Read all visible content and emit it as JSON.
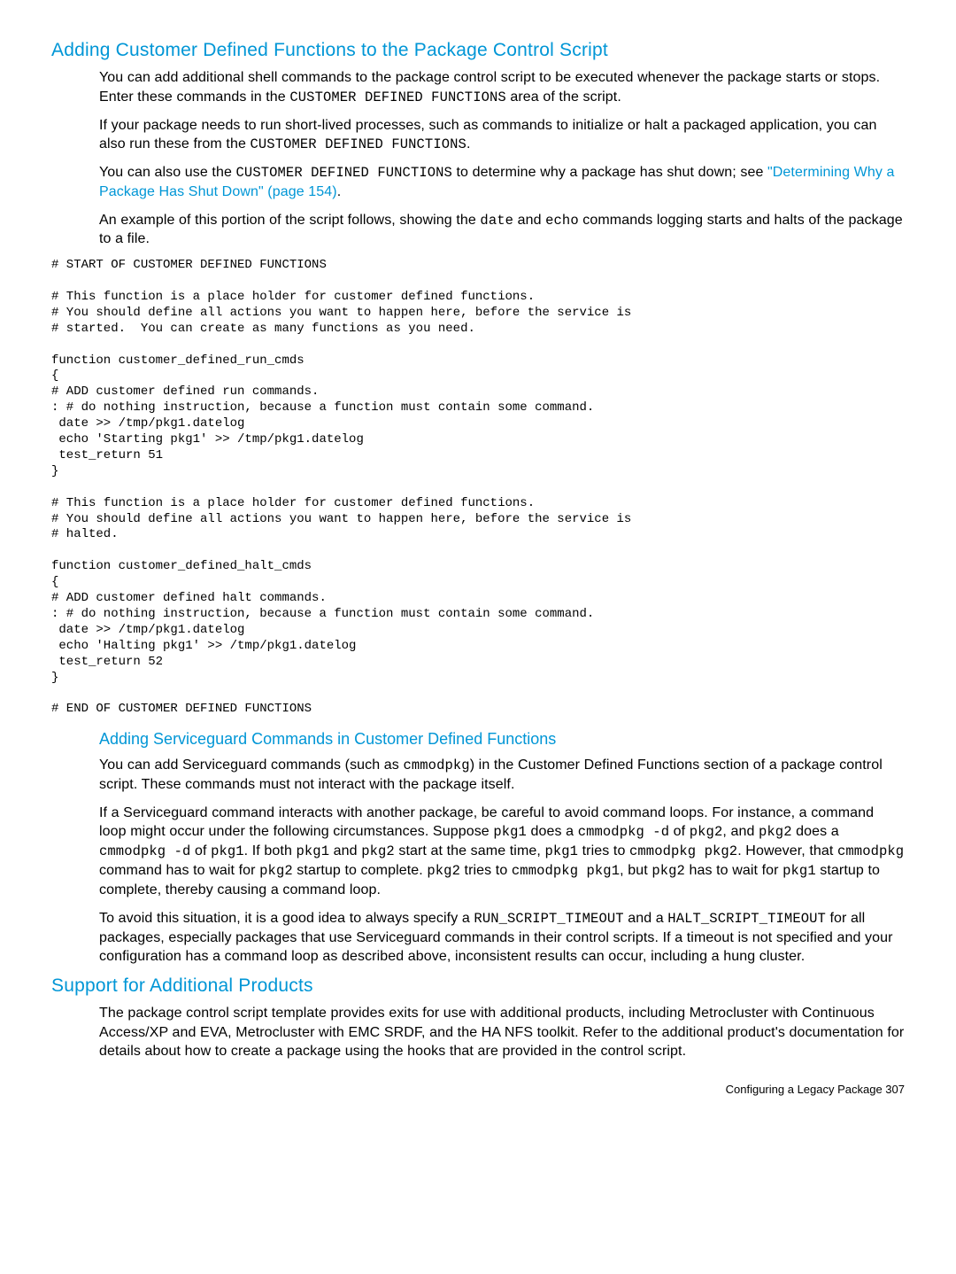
{
  "section1": {
    "heading": "Adding Customer Defined Functions to the Package Control Script",
    "p1_a": "You can add additional shell commands to the package control script to be executed whenever the package starts or stops. Enter these commands in the ",
    "p1_code": "CUSTOMER DEFINED FUNCTIONS",
    "p1_b": " area of the script.",
    "p2_a": "If your package needs to run short-lived processes, such as commands to initialize or halt a packaged application, you can also run these from the ",
    "p2_code": "CUSTOMER DEFINED FUNCTIONS",
    "p2_b": ".",
    "p3_a": "You can also use the ",
    "p3_code": "CUSTOMER DEFINED FUNCTIONS",
    "p3_b": " to determine why a package has shut down; see ",
    "p3_link": "\"Determining Why a Package Has Shut Down\" (page 154)",
    "p3_c": ".",
    "p4_a": "An example of this portion of the script follows, showing the ",
    "p4_code1": "date",
    "p4_b": " and ",
    "p4_code2": "echo",
    "p4_c": " commands logging starts and halts of the package to a file.",
    "code": "# START OF CUSTOMER DEFINED FUNCTIONS\n\n# This function is a place holder for customer defined functions.\n# You should define all actions you want to happen here, before the service is\n# started.  You can create as many functions as you need.\n\nfunction customer_defined_run_cmds\n{\n# ADD customer defined run commands.\n: # do nothing instruction, because a function must contain some command.\n date >> /tmp/pkg1.datelog\n echo 'Starting pkg1' >> /tmp/pkg1.datelog\n test_return 51\n}\n\n# This function is a place holder for customer defined functions.\n# You should define all actions you want to happen here, before the service is\n# halted.\n\nfunction customer_defined_halt_cmds\n{\n# ADD customer defined halt commands.\n: # do nothing instruction, because a function must contain some command.\n date >> /tmp/pkg1.datelog\n echo 'Halting pkg1' >> /tmp/pkg1.datelog\n test_return 52\n}\n\n# END OF CUSTOMER DEFINED FUNCTIONS"
  },
  "section2": {
    "heading": "Adding Serviceguard Commands in Customer Defined Functions",
    "p1_a": "You can add Serviceguard commands (such as ",
    "p1_code": "cmmodpkg",
    "p1_b": ") in the Customer Defined Functions section of a package control script. These commands must not interact with the package itself.",
    "p2_a": "If a Serviceguard command interacts with another package, be careful to avoid command loops. For instance, a command loop might occur under the following circumstances. Suppose ",
    "p2_c1": "pkg1",
    "p2_b": " does a ",
    "p2_c2": "cmmodpkg -d",
    "p2_c": " of ",
    "p2_c3": "pkg2",
    "p2_d": ", and ",
    "p2_c4": "pkg2",
    "p2_e": " does a ",
    "p2_c5": "cmmodpkg -d",
    "p2_f": " of ",
    "p2_c6": "pkg1",
    "p2_g": ". If both ",
    "p2_c7": "pkg1",
    "p2_h": " and ",
    "p2_c8": "pkg2",
    "p2_i": " start at the same time, ",
    "p2_c9": "pkg1",
    "p2_j": " tries to ",
    "p2_c10": "cmmodpkg pkg2",
    "p2_k": ". However, that ",
    "p2_c11": "cmmodpkg",
    "p2_l": " command has to wait for ",
    "p2_c12": "pkg2",
    "p2_m": " startup to complete. ",
    "p2_c13": "pkg2",
    "p2_n": " tries to ",
    "p2_c14": "cmmodpkg pkg1",
    "p2_o": ", but ",
    "p2_c15": "pkg2",
    "p2_p": " has to wait for ",
    "p2_c16": "pkg1",
    "p2_q": " startup to complete, thereby causing a command loop.",
    "p3_a": "To avoid this situation, it is a good idea to always specify a ",
    "p3_c1": "RUN_SCRIPT_TIMEOUT",
    "p3_b": " and a ",
    "p3_c2": "HALT_SCRIPT_TIMEOUT",
    "p3_c": " for all packages, especially packages that use Serviceguard commands in their control scripts. If a timeout is not specified and your configuration has a command loop as described above, inconsistent results can occur, including a hung cluster."
  },
  "section3": {
    "heading": "Support for Additional Products",
    "p1": "The package control script template provides exits for use with additional products, including Metrocluster with Continuous Access/XP and EVA, Metrocluster with EMC SRDF, and the HA NFS toolkit. Refer to the additional product's documentation for details about how to create a package using the hooks that are provided in the control script."
  },
  "footer": {
    "text": "Configuring a Legacy Package   307"
  }
}
